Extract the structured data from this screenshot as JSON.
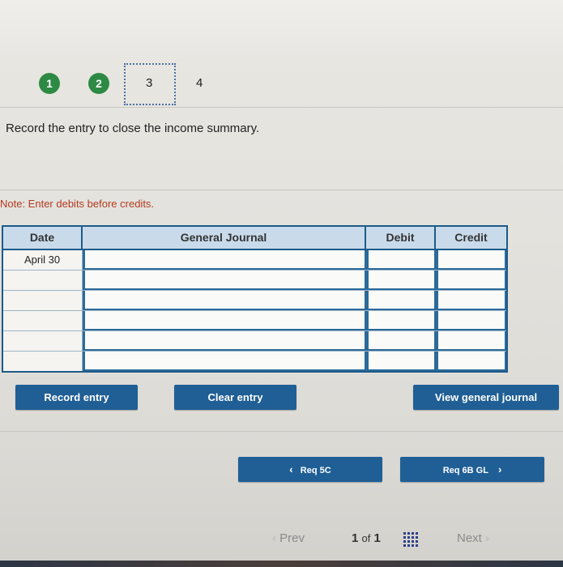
{
  "steps": {
    "items": [
      {
        "label": "1",
        "state": "complete"
      },
      {
        "label": "2",
        "state": "complete"
      },
      {
        "label": "3",
        "state": "active"
      },
      {
        "label": "4",
        "state": "upcoming"
      }
    ]
  },
  "instruction": "Record the entry to close the income summary.",
  "note": "Note: Enter debits before credits.",
  "journal": {
    "headers": {
      "date": "Date",
      "general_journal": "General Journal",
      "debit": "Debit",
      "credit": "Credit"
    },
    "rows": [
      {
        "date": "April 30",
        "account": "",
        "debit": "",
        "credit": ""
      },
      {
        "date": "",
        "account": "",
        "debit": "",
        "credit": ""
      },
      {
        "date": "",
        "account": "",
        "debit": "",
        "credit": ""
      },
      {
        "date": "",
        "account": "",
        "debit": "",
        "credit": ""
      },
      {
        "date": "",
        "account": "",
        "debit": "",
        "credit": ""
      },
      {
        "date": "",
        "account": "",
        "debit": "",
        "credit": ""
      }
    ]
  },
  "actions": {
    "record": "Record entry",
    "clear": "Clear entry",
    "view_journal": "View general journal"
  },
  "nav": {
    "prev_req": "Req 5C",
    "next_req": "Req 6B GL"
  },
  "pager": {
    "prev": "Prev",
    "current": "1",
    "of": "of",
    "total": "1",
    "next": "Next"
  },
  "colors": {
    "accent": "#1f5f95",
    "step_complete": "#2d8a44",
    "note_text": "#b23a1f"
  }
}
